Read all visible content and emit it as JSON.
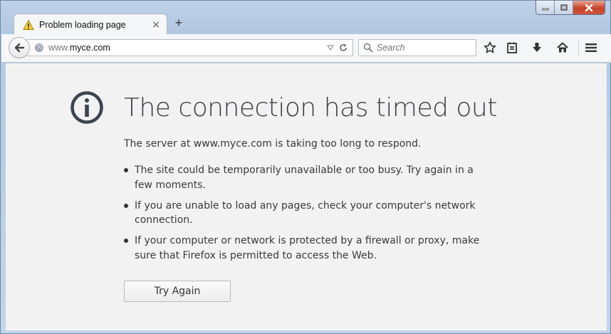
{
  "window": {
    "controls": [
      "minimize",
      "maximize",
      "close"
    ]
  },
  "tab": {
    "title": "Problem loading page",
    "icon": "warning-icon",
    "close_glyph": "×"
  },
  "newtab": {
    "glyph": "+"
  },
  "navbar": {
    "url_prefix": "www.",
    "url_domain": "myce.com",
    "search_placeholder": "Search",
    "icons": [
      "back-arrow-icon",
      "globe-icon",
      "dropdown-icon",
      "reload-icon",
      "search-icon",
      "bookmark-star-icon",
      "reading-list-icon",
      "download-icon",
      "home-icon",
      "menu-icon"
    ]
  },
  "error": {
    "title": "The connection has timed out",
    "lead": "The server at www.myce.com is taking too long to respond.",
    "bullets": [
      "The site could be temporarily unavailable or too busy. Try again in a few moments.",
      "If you are unable to load any pages, check your computer's network connection.",
      "If your computer or network is protected by a firewall or proxy, make sure that Firefox is permitted to access the Web."
    ],
    "button": "Try Again"
  },
  "colors": {
    "content_bg": "#f2f2f2",
    "title_text": "#3d3d44",
    "icon": "#3d4450",
    "close_red": "#c5452b"
  }
}
